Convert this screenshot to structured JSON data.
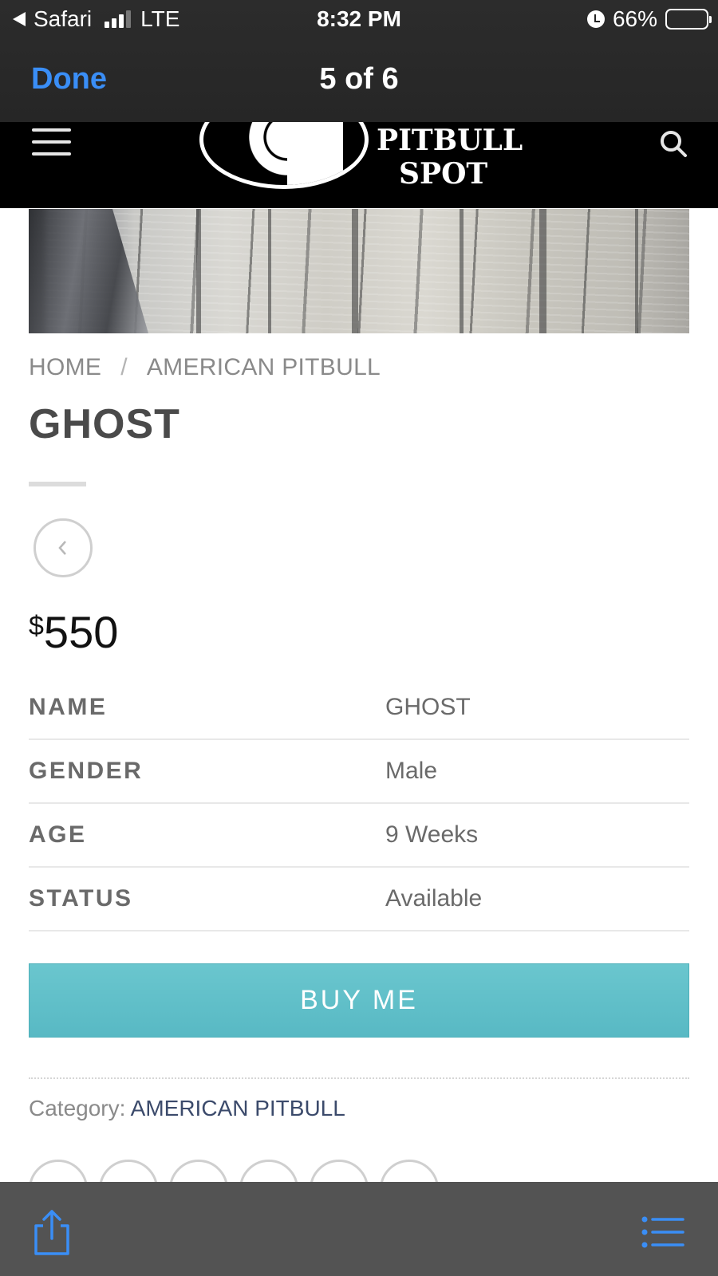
{
  "status_bar": {
    "back_app": "Safari",
    "network": "LTE",
    "time": "8:32 PM",
    "battery": "66%",
    "battery_level": 0.66,
    "signal_bars": 3
  },
  "viewer": {
    "done_label": "Done",
    "counter": "5 of 6"
  },
  "site": {
    "logo_line1": "PITBULL",
    "logo_line2": "SPOT",
    "icons": {
      "menu": "hamburger-menu-icon",
      "search": "search-icon"
    }
  },
  "breadcrumb": {
    "home": "HOME",
    "separator": "/",
    "category": "AMERICAN PITBULL"
  },
  "product": {
    "title": "GHOST",
    "currency": "$",
    "price": "550",
    "details": [
      {
        "label": "NAME",
        "value": "GHOST"
      },
      {
        "label": "GENDER",
        "value": "Male"
      },
      {
        "label": "AGE",
        "value": "9 Weeks"
      },
      {
        "label": "STATUS",
        "value": "Available"
      }
    ],
    "buy_label": "BUY ME",
    "category_label": "Category:",
    "category_value": "AMERICAN PITBULL"
  },
  "colors": {
    "accent": "#3a8ef6",
    "buy_button": "#5fbfc9",
    "category_link": "#3b4a6b",
    "site_header": "#000000",
    "toolbar": "#535353"
  },
  "toolbar": {
    "share_icon": "share-icon",
    "list_icon": "list-icon"
  }
}
